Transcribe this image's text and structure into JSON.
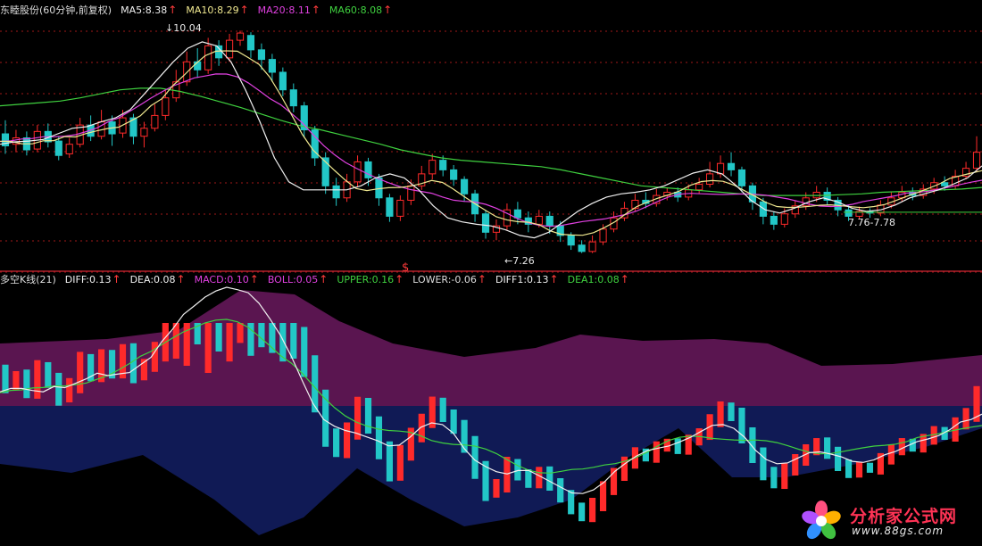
{
  "top_legend": [
    {
      "text": "东睦股份(60分钟,前复权)",
      "color": "#dddddd",
      "arrow": false
    },
    {
      "text": "MA5:8.38",
      "color": "#f0f0f0",
      "arrow": true
    },
    {
      "text": "MA10:8.29",
      "color": "#f0e890",
      "arrow": true
    },
    {
      "text": "MA20:8.11",
      "color": "#e040e0",
      "arrow": true
    },
    {
      "text": "MA60:8.08",
      "color": "#3fd13f",
      "arrow": true
    }
  ],
  "bottom_legend": [
    {
      "text": "多空K线(21)",
      "color": "#dddddd",
      "arrow": false
    },
    {
      "text": "DIFF:0.13",
      "color": "#f0f0f0",
      "arrow": true
    },
    {
      "text": "DEA:0.08",
      "color": "#f0f0f0",
      "arrow": true
    },
    {
      "text": "MACD:0.10",
      "color": "#e040e0",
      "arrow": true
    },
    {
      "text": "BOLL:0.05",
      "color": "#e040e0",
      "arrow": true
    },
    {
      "text": "UPPER:0.16",
      "color": "#3fd13f",
      "arrow": true
    },
    {
      "text": "LOWER:-0.06",
      "color": "#dddddd",
      "arrow": true
    },
    {
      "text": "DIFF1:0.13",
      "color": "#f0f0f0",
      "arrow": true
    },
    {
      "text": "DEA1:0.08",
      "color": "#3fd13f",
      "arrow": true
    }
  ],
  "annotations": {
    "high_label": "10.04",
    "low_label": "7.26",
    "range_label": "7.76-7.78",
    "marker_symbol": "$"
  },
  "colors": {
    "up": "#ff2a2a",
    "down": "#22c7c7",
    "ma5": "#f0f0f0",
    "ma10": "#f0e890",
    "ma20": "#e040e0",
    "ma60": "#3fd13f",
    "upper_band": "#5a1550",
    "lower_band": "#101a55",
    "separator": "#b0202a",
    "grid": "#a01818"
  },
  "logo": {
    "title": "分析家公式网",
    "url": "www.88gs.com"
  },
  "chart_data": {
    "type": "candlestick",
    "title": "东睦股份(60分钟,前复权)",
    "main_ylim": [
      7.1,
      10.2
    ],
    "main_candles": [
      [
        8.75,
        8.6,
        8.92,
        8.5
      ],
      [
        8.62,
        8.7,
        8.8,
        8.52
      ],
      [
        8.7,
        8.55,
        8.78,
        8.48
      ],
      [
        8.56,
        8.78,
        8.86,
        8.52
      ],
      [
        8.78,
        8.65,
        8.88,
        8.58
      ],
      [
        8.66,
        8.48,
        8.72,
        8.42
      ],
      [
        8.5,
        8.62,
        8.7,
        8.45
      ],
      [
        8.62,
        8.86,
        8.95,
        8.58
      ],
      [
        8.86,
        8.72,
        8.98,
        8.66
      ],
      [
        8.72,
        8.9,
        9.05,
        8.68
      ],
      [
        8.9,
        8.75,
        8.98,
        8.6
      ],
      [
        8.76,
        8.95,
        9.05,
        8.7
      ],
      [
        8.95,
        8.72,
        9.0,
        8.62
      ],
      [
        8.72,
        8.82,
        8.9,
        8.58
      ],
      [
        8.82,
        8.98,
        9.12,
        8.78
      ],
      [
        8.98,
        9.2,
        9.3,
        8.92
      ],
      [
        9.2,
        9.4,
        9.55,
        9.15
      ],
      [
        9.4,
        9.65,
        9.78,
        9.35
      ],
      [
        9.65,
        9.55,
        9.82,
        9.45
      ],
      [
        9.55,
        9.85,
        9.95,
        9.5
      ],
      [
        9.85,
        9.7,
        9.92,
        9.6
      ],
      [
        9.7,
        9.92,
        10.0,
        9.65
      ],
      [
        9.92,
        10.01,
        10.04,
        9.85
      ],
      [
        9.98,
        9.8,
        10.02,
        9.7
      ],
      [
        9.8,
        9.68,
        9.88,
        9.55
      ],
      [
        9.68,
        9.52,
        9.75,
        9.4
      ],
      [
        9.52,
        9.3,
        9.58,
        9.22
      ],
      [
        9.3,
        9.1,
        9.38,
        9.02
      ],
      [
        9.1,
        8.8,
        9.15,
        8.7
      ],
      [
        8.8,
        8.45,
        8.85,
        8.35
      ],
      [
        8.45,
        8.1,
        8.52,
        8.0
      ],
      [
        8.1,
        7.95,
        8.2,
        7.85
      ],
      [
        7.95,
        8.15,
        8.25,
        7.9
      ],
      [
        8.15,
        8.4,
        8.48,
        8.08
      ],
      [
        8.4,
        8.2,
        8.45,
        8.1
      ],
      [
        8.2,
        7.95,
        8.25,
        7.85
      ],
      [
        7.95,
        7.72,
        8.0,
        7.65
      ],
      [
        7.72,
        7.92,
        7.98,
        7.66
      ],
      [
        7.92,
        8.1,
        8.18,
        7.86
      ],
      [
        8.1,
        8.25,
        8.35,
        8.05
      ],
      [
        8.25,
        8.42,
        8.5,
        8.18
      ],
      [
        8.42,
        8.3,
        8.48,
        8.22
      ],
      [
        8.3,
        8.18,
        8.36,
        8.1
      ],
      [
        8.18,
        8.0,
        8.22,
        7.9
      ],
      [
        8.0,
        7.75,
        8.05,
        7.65
      ],
      [
        7.75,
        7.52,
        7.8,
        7.44
      ],
      [
        7.52,
        7.6,
        7.68,
        7.42
      ],
      [
        7.6,
        7.8,
        7.88,
        7.55
      ],
      [
        7.8,
        7.7,
        7.9,
        7.62
      ],
      [
        7.7,
        7.62,
        7.78,
        7.52
      ],
      [
        7.62,
        7.72,
        7.8,
        7.58
      ],
      [
        7.72,
        7.6,
        7.78,
        7.5
      ],
      [
        7.6,
        7.48,
        7.66,
        7.4
      ],
      [
        7.48,
        7.36,
        7.52,
        7.3
      ],
      [
        7.36,
        7.28,
        7.42,
        7.26
      ],
      [
        7.28,
        7.4,
        7.48,
        7.26
      ],
      [
        7.4,
        7.56,
        7.62,
        7.36
      ],
      [
        7.56,
        7.7,
        7.78,
        7.52
      ],
      [
        7.7,
        7.82,
        7.9,
        7.66
      ],
      [
        7.82,
        7.92,
        8.0,
        7.78
      ],
      [
        7.92,
        7.88,
        8.02,
        7.82
      ],
      [
        7.88,
        7.98,
        8.06,
        7.84
      ],
      [
        7.98,
        8.02,
        8.08,
        7.92
      ],
      [
        8.02,
        7.96,
        8.08,
        7.9
      ],
      [
        7.96,
        8.05,
        8.12,
        7.92
      ],
      [
        8.05,
        8.12,
        8.2,
        8.0
      ],
      [
        8.12,
        8.25,
        8.4,
        8.08
      ],
      [
        8.25,
        8.38,
        8.48,
        8.2
      ],
      [
        8.38,
        8.3,
        8.52,
        8.22
      ],
      [
        8.3,
        8.1,
        8.34,
        8.02
      ],
      [
        8.1,
        7.9,
        8.14,
        7.8
      ],
      [
        7.9,
        7.72,
        7.95,
        7.62
      ],
      [
        7.72,
        7.62,
        7.78,
        7.55
      ],
      [
        7.62,
        7.75,
        7.82,
        7.58
      ],
      [
        7.75,
        7.85,
        7.92,
        7.7
      ],
      [
        7.85,
        7.95,
        8.02,
        7.8
      ],
      [
        7.95,
        8.02,
        8.1,
        7.9
      ],
      [
        8.02,
        7.92,
        8.08,
        7.86
      ],
      [
        7.92,
        7.8,
        7.96,
        7.72
      ],
      [
        7.8,
        7.72,
        7.86,
        7.66
      ],
      [
        7.72,
        7.78,
        7.84,
        7.68
      ],
      [
        7.78,
        7.76,
        7.82,
        7.7
      ],
      [
        7.76,
        7.86,
        7.92,
        7.72
      ],
      [
        7.86,
        7.95,
        8.02,
        7.82
      ],
      [
        7.95,
        8.02,
        8.1,
        7.9
      ],
      [
        8.02,
        7.98,
        8.08,
        7.92
      ],
      [
        7.98,
        8.06,
        8.12,
        7.94
      ],
      [
        8.06,
        8.14,
        8.2,
        8.0
      ],
      [
        8.14,
        8.1,
        8.22,
        8.04
      ],
      [
        8.1,
        8.22,
        8.3,
        8.06
      ],
      [
        8.22,
        8.32,
        8.4,
        8.18
      ],
      [
        8.32,
        8.52,
        8.72,
        8.28
      ]
    ],
    "ma5": [
      8.62,
      8.65,
      8.66,
      8.68,
      8.75,
      8.82,
      8.84,
      8.9,
      8.95,
      9.05,
      9.25,
      9.45,
      9.65,
      9.82,
      9.9,
      9.85,
      9.65,
      9.3,
      8.9,
      8.45,
      8.15,
      8.05,
      8.05,
      8.05,
      8.05,
      8.1,
      8.2,
      8.25,
      8.2,
      8.05,
      7.85,
      7.7,
      7.65,
      7.62,
      7.6,
      7.55,
      7.48,
      7.45,
      7.52,
      7.65,
      7.78,
      7.88,
      7.96,
      8.0,
      8.02,
      8.05,
      8.1,
      8.18,
      8.26,
      8.3,
      8.25,
      8.1,
      7.92,
      7.8,
      7.76,
      7.82,
      7.9,
      7.95,
      7.9,
      7.82,
      7.78,
      7.8,
      7.86,
      7.95,
      8.0,
      8.05,
      8.12,
      8.2,
      8.35
    ],
    "ma60": [
      9.1,
      9.12,
      9.14,
      9.16,
      9.2,
      9.25,
      9.3,
      9.32,
      9.32,
      9.28,
      9.22,
      9.15,
      9.08,
      9.0,
      8.92,
      8.85,
      8.8,
      8.74,
      8.68,
      8.62,
      8.55,
      8.5,
      8.45,
      8.42,
      8.4,
      8.38,
      8.36,
      8.34,
      8.3,
      8.25,
      8.2,
      8.15,
      8.1,
      8.08,
      8.06,
      8.04,
      8.02,
      8.0,
      7.98,
      7.98,
      7.98,
      7.98,
      7.99,
      8.0,
      8.02,
      8.03,
      8.04,
      8.05,
      8.06,
      8.08
    ]
  }
}
